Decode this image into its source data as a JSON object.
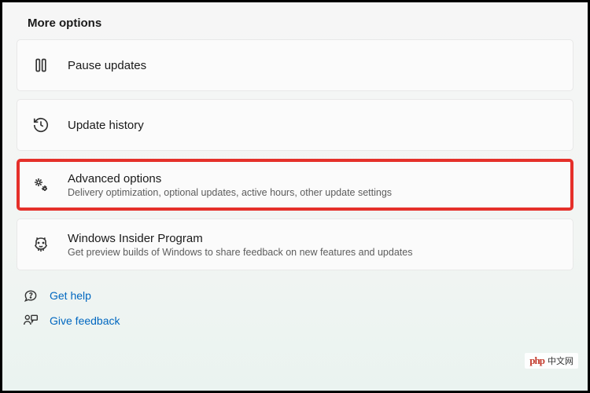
{
  "section": {
    "title": "More options"
  },
  "cards": {
    "pause": {
      "title": "Pause updates"
    },
    "history": {
      "title": "Update history"
    },
    "advanced": {
      "title": "Advanced options",
      "subtitle": "Delivery optimization, optional updates, active hours, other update settings"
    },
    "insider": {
      "title": "Windows Insider Program",
      "subtitle": "Get preview builds of Windows to share feedback on new features and updates"
    }
  },
  "links": {
    "help": "Get help",
    "feedback": "Give feedback"
  },
  "watermark": {
    "brand": "php",
    "text": "中文网"
  }
}
